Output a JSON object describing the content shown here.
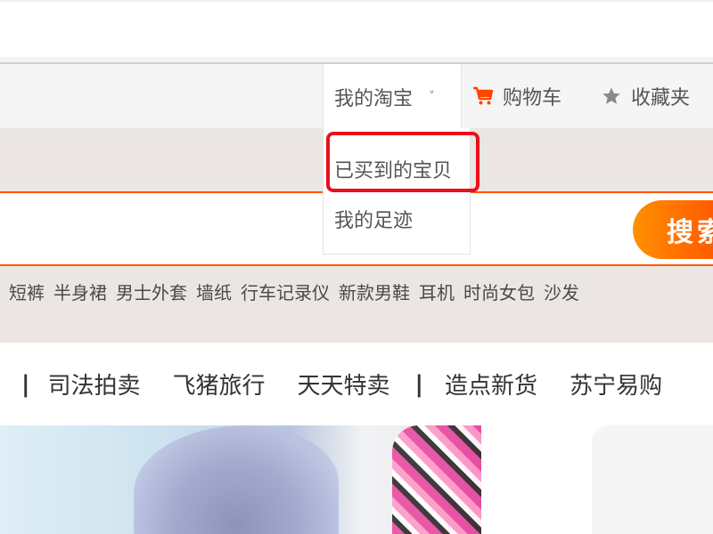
{
  "site_nav": {
    "my_taobao": "我的淘宝",
    "cart": "购物车",
    "favorites": "收藏夹"
  },
  "dropdown": {
    "items": [
      "已买到的宝贝",
      "我的足迹"
    ]
  },
  "search": {
    "value": "",
    "button": "搜索"
  },
  "hot_words": [
    "短裤",
    "半身裙",
    "男士外套",
    "墙纸",
    "行车记录仪",
    "新款男鞋",
    "耳机",
    "时尚女包",
    "沙发"
  ],
  "channels": {
    "separator": "|",
    "items": [
      "司法拍卖",
      "飞猪旅行",
      "天天特卖",
      "造点新货",
      "苏宁易购"
    ]
  },
  "colors": {
    "brand_orange": "#ff5500",
    "highlight_red": "#e8101b",
    "cart_icon": "#ff4400"
  },
  "icons": {
    "chevron": "chevron-down-icon",
    "cart": "cart-icon",
    "favorites": "star-icon"
  }
}
